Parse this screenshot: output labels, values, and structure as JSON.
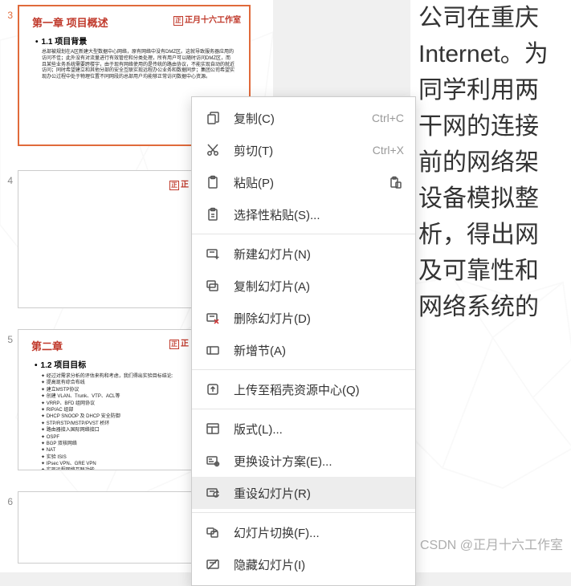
{
  "thumbs": {
    "slide3": {
      "num": "3",
      "title": "第一章 项目概述",
      "sub": "1.1 项目背景",
      "logo": "正月十六工作室",
      "body": "总部被规划在A区新建大型数据中心网络，原有网络中没有DMZ区。这就导致服务器应用的访问不佳；此外没有对流量进行有效管控和分类处理，所有用户可以随时访问DMZ区，而且某些业务系统需要跨楼宇，由于现有网络使用的是传统的路由协议，不能实现自动的就近访问；同时希望建立和其他分部的安全互联实现远程办公业务和数据同步；集团公司希望实现办公过程中处于物理位置不同网段的总部用户均能够正常访问数据中心资源。"
    },
    "slide4": {
      "num": "4",
      "logo": "正"
    },
    "slide5": {
      "num": "5",
      "title": "第二章",
      "sub": "1.2 项目目标",
      "logo": "正",
      "bullets": [
        "经过对需求分析的评估来构和考虑，我们得出实验目标结论:",
        "提高现有综合布线",
        "建立MSTP协议",
        "创建 VLAN、Trunk、VTP、ACL等",
        "VRRP、BFD 组网协议",
        "RIP/AC 组部",
        "DHCP SNOOP 及 DHCP 安全防御",
        "STP/RSTP/MSTP/PVST 桥环",
        "路由器接入国际网络接口",
        "OSPF",
        "BGP 双核网络",
        "NAT",
        "实验 ISIS",
        "IPsec VPN、GRE VPN",
        "实现远程网络互联功能"
      ]
    },
    "slide6": {
      "num": "6"
    }
  },
  "main_text": [
    "公司在重庆",
    "Internet。为",
    "同学利用两",
    "干网的连接",
    "前的网络架",
    "设备模拟整",
    "析，得出网",
    "及可靠性和",
    "网络系统的"
  ],
  "menu": {
    "copy": {
      "label": "复制(C)",
      "shortcut": "Ctrl+C"
    },
    "cut": {
      "label": "剪切(T)",
      "shortcut": "Ctrl+X"
    },
    "paste": {
      "label": "粘贴(P)"
    },
    "paste_special": {
      "label": "选择性粘贴(S)..."
    },
    "new_slide": {
      "label": "新建幻灯片(N)"
    },
    "dup_slide": {
      "label": "复制幻灯片(A)"
    },
    "del_slide": {
      "label": "删除幻灯片(D)"
    },
    "new_section": {
      "label": "新增节(A)"
    },
    "upload": {
      "label": "上传至稻壳资源中心(Q)"
    },
    "layout": {
      "label": "版式(L)..."
    },
    "change_design": {
      "label": "更换设计方案(E)..."
    },
    "reset_slide": {
      "label": "重设幻灯片(R)"
    },
    "transition": {
      "label": "幻灯片切换(F)..."
    },
    "hide_slide": {
      "label": "隐藏幻灯片(I)"
    }
  },
  "watermark": "CSDN @正月十六工作室"
}
